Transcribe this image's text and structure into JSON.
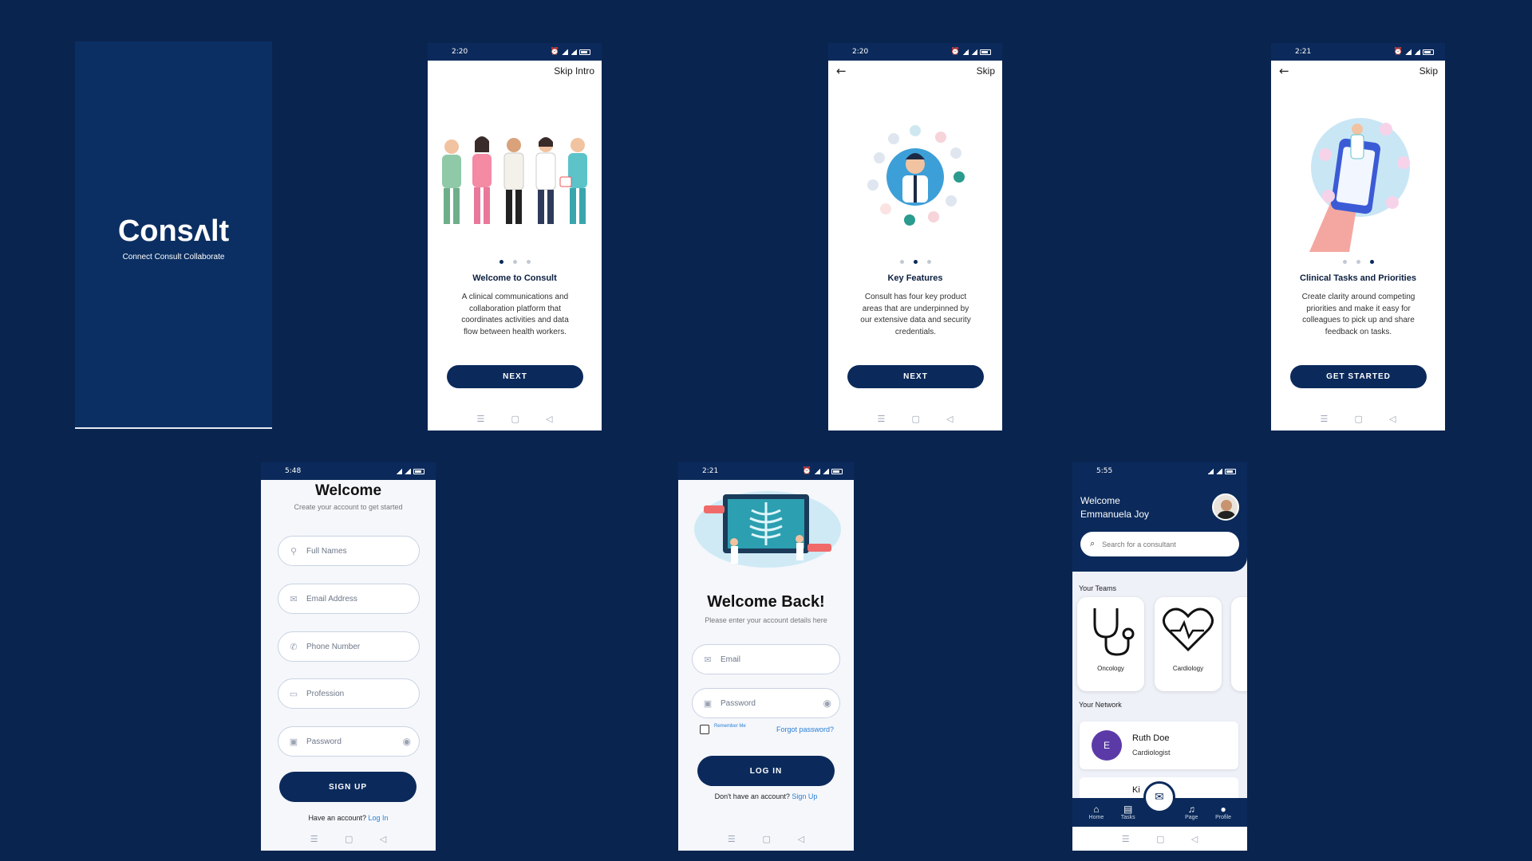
{
  "splash": {
    "logo": "Consʌlt",
    "tagline": "Connect Consult Collaborate"
  },
  "onboarding1": {
    "time": "2:20",
    "skip_label": "Skip Intro",
    "title": "Welcome to Consult",
    "description": "A clinical communications and collaboration platform that coordinates activities and data flow between health workers.",
    "button_label": "NEXT"
  },
  "onboarding2": {
    "time": "2:20",
    "skip_label": "Skip",
    "title": "Key Features",
    "description": "Consult has four key product areas that are underpinned by our extensive data and security credentials.",
    "button_label": "NEXT"
  },
  "onboarding3": {
    "time": "2:21",
    "skip_label": "Skip",
    "title": "Clinical Tasks and Priorities",
    "description": "Create clarity around competing priorities and make it easy for colleagues to pick up and share feedback on tasks.",
    "button_label": "GET STARTED"
  },
  "signup": {
    "time": "5:48",
    "title": "Welcome",
    "subtitle": "Create your account to get started",
    "fields": [
      {
        "placeholder": "Full Names",
        "icon": "person-icon"
      },
      {
        "placeholder": "Email Address",
        "icon": "mail-icon"
      },
      {
        "placeholder": "Phone Number",
        "icon": "phone-icon"
      },
      {
        "placeholder": "Profession",
        "icon": "briefcase-icon"
      },
      {
        "placeholder": "Password",
        "icon": "lock-icon"
      }
    ],
    "button_label": "SIGN UP",
    "footer_text": "Have an account?",
    "footer_link": "Log In"
  },
  "login": {
    "time": "2:21",
    "title": "Welcome Back!",
    "subtitle": "Please enter your account details here",
    "email_placeholder": "Email",
    "password_placeholder": "Password",
    "remember_label": "Remember Me",
    "forgot_label": "Forgot password?",
    "button_label": "LOG IN",
    "footer_text": "Don't have an account?",
    "footer_link": "Sign Up"
  },
  "home": {
    "time": "5:55",
    "welcome_line1": "Welcome",
    "welcome_line2": "Emmanuela Joy",
    "search_placeholder": "Search for a consultant",
    "teams_heading": "Your Teams",
    "teams": [
      {
        "label": "Oncology",
        "icon": "stethoscope-icon"
      },
      {
        "label": "Cardiology",
        "icon": "heart-pulse-icon"
      }
    ],
    "network_heading": "Your Network",
    "contact": {
      "initial": "E",
      "name": "Ruth Doe",
      "role": "Cardiologist"
    },
    "partial_contact_text": "Ki",
    "tabs": [
      {
        "label": "Home",
        "icon": "home-icon"
      },
      {
        "label": "Tasks",
        "icon": "document-icon"
      },
      {
        "label": "Page",
        "icon": "bell-icon"
      },
      {
        "label": "Profile",
        "icon": "account-icon"
      }
    ]
  },
  "colors": {
    "background": "#0a2450",
    "primary": "#0b2a5b",
    "accent_link": "#2a7fd4",
    "avatar": "#5b3aa8"
  }
}
